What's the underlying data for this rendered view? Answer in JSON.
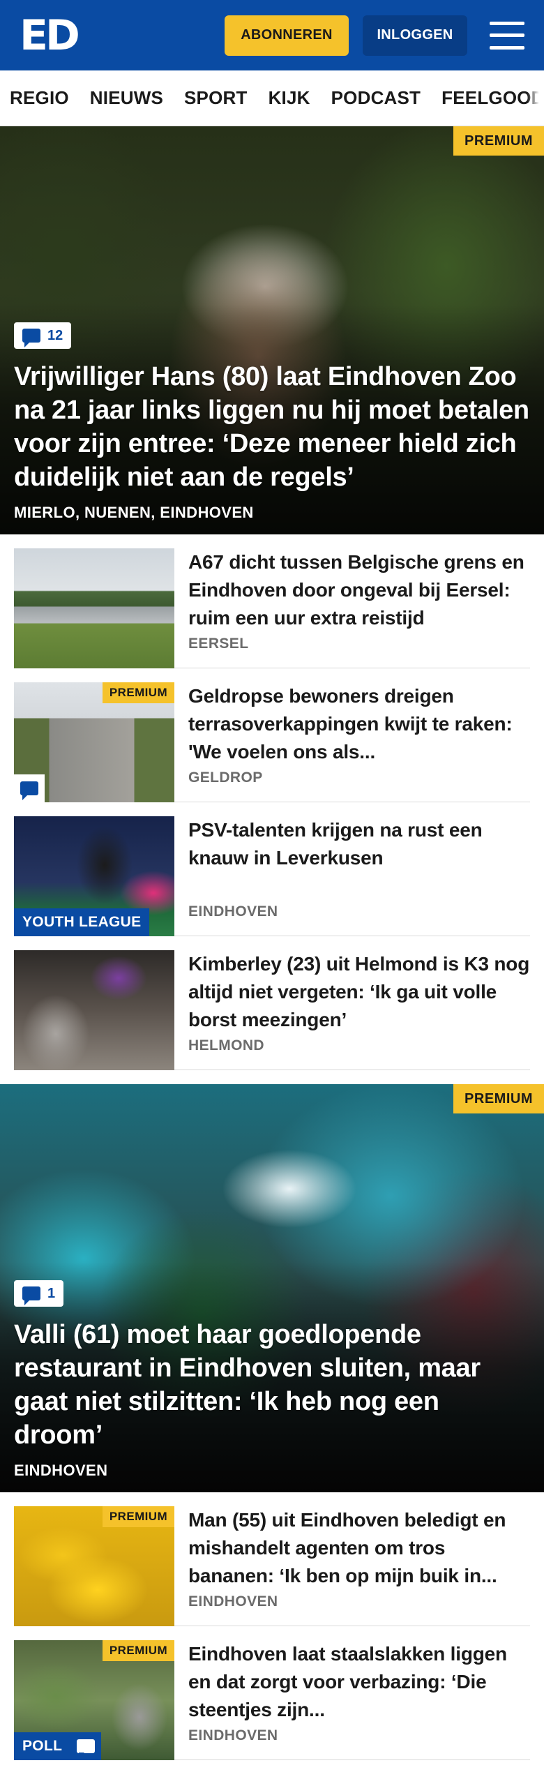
{
  "header": {
    "logo": "ED",
    "subscribe_label": "ABONNEREN",
    "login_label": "INLOGGEN"
  },
  "nav": {
    "items": [
      "REGIO",
      "NIEUWS",
      "SPORT",
      "KIJK",
      "PODCAST",
      "FEELGOOD"
    ]
  },
  "hero_1": {
    "tag": "PREMIUM",
    "comments": "12",
    "title": "Vrijwilliger Hans (80) laat Eindhoven Zoo na 21 jaar links liggen nu hij moet betalen voor zijn entree: ‘Deze meneer hield zich duidelijk niet aan de regels’",
    "location": "MIERLO, NUENEN, EINDHOVEN"
  },
  "list_1": [
    {
      "title": "A67 dicht tussen Belgische grens en Eindhoven door ongeval bij Eersel: ruim een uur extra reistijd",
      "location": "EERSEL"
    },
    {
      "tag": "PREMIUM",
      "title": "Geldropse bewoners dreigen terrasoverkappingen kwijt te raken: 'We voelen ons als...",
      "location": "GELDROP"
    },
    {
      "label": "YOUTH LEAGUE",
      "title": "PSV-talenten krijgen na rust een knauw in Leverkusen",
      "location": "EINDHOVEN"
    },
    {
      "title": "Kimberley (23) uit Helmond is K3 nog altijd niet vergeten: ‘Ik ga uit volle borst meezingen’",
      "location": "HELMOND"
    }
  ],
  "hero_2": {
    "tag": "PREMIUM",
    "comments": "1",
    "title": "Valli (61) moet haar goedlopende restaurant in Eindhoven sluiten, maar gaat niet stilzitten: ‘Ik heb nog een droom’",
    "location": "EINDHOVEN"
  },
  "list_2": [
    {
      "tag": "PREMIUM",
      "title": "Man (55) uit Eindhoven beledigt en mishandelt agenten om tros bananen: ‘Ik ben op mijn buik in...",
      "location": "EINDHOVEN"
    },
    {
      "tag": "PREMIUM",
      "label": "POLL",
      "title": "Eindhoven laat staalslakken liggen en dat zorgt voor verbazing: ‘Die steentjes zijn...",
      "location": "EINDHOVEN"
    }
  ],
  "colors": {
    "brand_blue": "#0a4ba3",
    "premium_yellow": "#f5c22b"
  },
  "icons": [
    "comment-icon",
    "menu-icon"
  ]
}
